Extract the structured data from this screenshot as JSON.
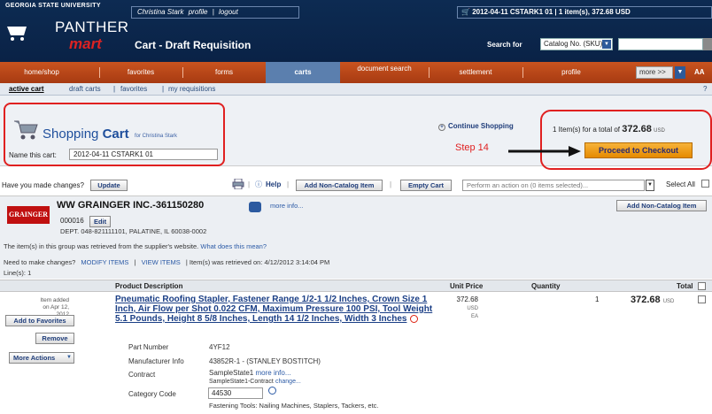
{
  "header": {
    "university": "GEORGIA STATE UNIVERSITY",
    "logo_top": "PANTHER",
    "logo_bottom": "mart",
    "user_name": "Christina Stark",
    "profile_link": "profile",
    "logout_link": "logout",
    "page_title": "Cart - Draft Requisition",
    "cart_status": "2012-04-11 CSTARK1 01 | 1 item(s), 372.68 USD",
    "search_label": "Search for",
    "search_select": "Catalog No. (SKU)"
  },
  "nav": {
    "items": [
      "home/shop",
      "favorites",
      "forms",
      "carts",
      "document search",
      "settlement",
      "profile"
    ],
    "more": "more >>",
    "text_size": "AA"
  },
  "subnav": {
    "items": [
      "active cart",
      "draft carts",
      "favorites",
      "my requisitions"
    ],
    "help": "?"
  },
  "cart": {
    "heading_plain": "Shopping ",
    "heading_bold": "Cart",
    "for_text": "for Christina Stark",
    "name_label": "Name this cart:",
    "name_value": "2012-04-11 CSTARK1 01",
    "continue": "Continue Shopping",
    "summary_prefix": "1 Item(s)  for a total of",
    "summary_total": "372.68",
    "summary_currency": "USD",
    "step_label": "Step 14",
    "checkout": "Proceed to Checkout"
  },
  "actions": {
    "changes_label": "Have you made changes?",
    "update": "Update",
    "help": "Help",
    "add_non_catalog": "Add Non-Catalog Item",
    "empty_cart": "Empty Cart",
    "perform_placeholder": "Perform an action on (0 items selected)...",
    "select_all": "Select All"
  },
  "supplier": {
    "logo_text": "GRAINGER",
    "name": "WW GRAINGER INC.-361150280",
    "more_info": "more info...",
    "number": "000016",
    "edit": "Edit",
    "address": "DEPT. 048-821111101, PALATINE, IL 60038-0002",
    "add_non_catalog": "Add Non-Catalog Item",
    "note": "The item(s) in this group was retrieved from the supplier's website.",
    "note_link": "What does this mean?",
    "changes_label": "Need to make changes?",
    "modify_items": "MODIFY ITEMS",
    "view_items": "VIEW ITEMS",
    "retrieved": "Item(s) was retrieved on: 4/12/2012 3:14:04 PM",
    "lines": "Line(s): 1"
  },
  "table": {
    "headers": [
      "Product Description",
      "Unit Price",
      "Quantity",
      "Total"
    ],
    "item": {
      "added": "Item added on Apr 12, 2012",
      "add_favorites": "Add to Favorites",
      "remove": "Remove",
      "more_actions": "More Actions",
      "title": "Pneumatic Roofing Stapler, Fastener Range 1/2-1 1/2 Inches, Crown Size 1 Inch, Air Flow per Shot 0.022 CFM, Maximum Pressure 100 PSI, Tool Weight 5.1 Pounds, Height 8 5/8 Inches, Length 14 1/2 Inches, Width 3 Inches",
      "unit_price": "372.68",
      "currency": "USD",
      "uom": "EA",
      "quantity": "1",
      "total": "372.68",
      "part_number_label": "Part Number",
      "part_number": "4YF12",
      "manufacturer_label": "Manufacturer Info",
      "manufacturer": "43852R-1 - (STANLEY BOSTITCH)",
      "contract_label": "Contract",
      "contract": "SampleState1",
      "contract_more": "more info...",
      "contract_sub": "SampleState1-Contract",
      "contract_change": "change...",
      "category_label": "Category Code",
      "category_code": "44530",
      "category_desc": "Fastening Tools: Nailing Machines, Staplers, Tackers, etc."
    }
  },
  "colors": {
    "header_bg": "#0d2b52",
    "nav_bg": "#b8461a",
    "nav_active": "#5b7fae",
    "highlight": "#e02020",
    "checkout_btn": "#f0a020"
  }
}
